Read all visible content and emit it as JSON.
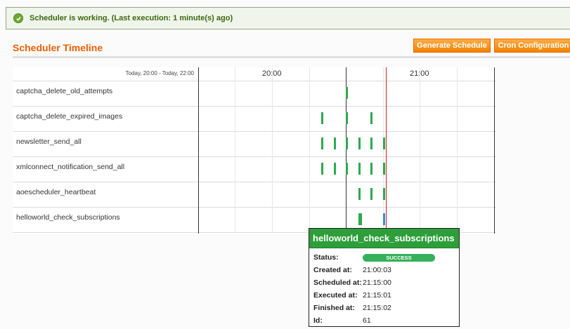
{
  "message": {
    "text": "Scheduler is working. (Last execution: 1 minute(s) ago)",
    "icon": "check-circle-icon"
  },
  "header": {
    "title": "Scheduler Timeline",
    "buttons": {
      "generate": "Generate Schedule",
      "cron": "Cron Configuration"
    }
  },
  "timeline": {
    "range_label": "Today, 20:00 - Today, 22:00",
    "hours": [
      "20:00",
      "21:00"
    ],
    "rows": [
      {
        "label": "captcha_delete_old_attempts"
      },
      {
        "label": "captcha_delete_expired_images"
      },
      {
        "label": "newsletter_send_all"
      },
      {
        "label": "xmlconnect_notification_send_all"
      },
      {
        "label": "aoescheduler_heartbeat"
      },
      {
        "label": "helloworld_check_subscriptions"
      }
    ]
  },
  "tooltip": {
    "title": "helloworld_check_subscriptions",
    "status_label": "Status:",
    "status_value": "SUCCESS",
    "created_label": "Created at:",
    "created_value": "21:00:03",
    "scheduled_label": "Scheduled at:",
    "scheduled_value": "21:15:00",
    "executed_label": "Executed at:",
    "executed_value": "21:15:01",
    "finished_label": "Finished at:",
    "finished_value": "21:15:02",
    "id_label": "Id:",
    "id_value": "61"
  },
  "colors": {
    "accent": "#eb5e00",
    "success": "#2fa84f",
    "running": "#3b8bd6",
    "now_line": "#d62020"
  }
}
